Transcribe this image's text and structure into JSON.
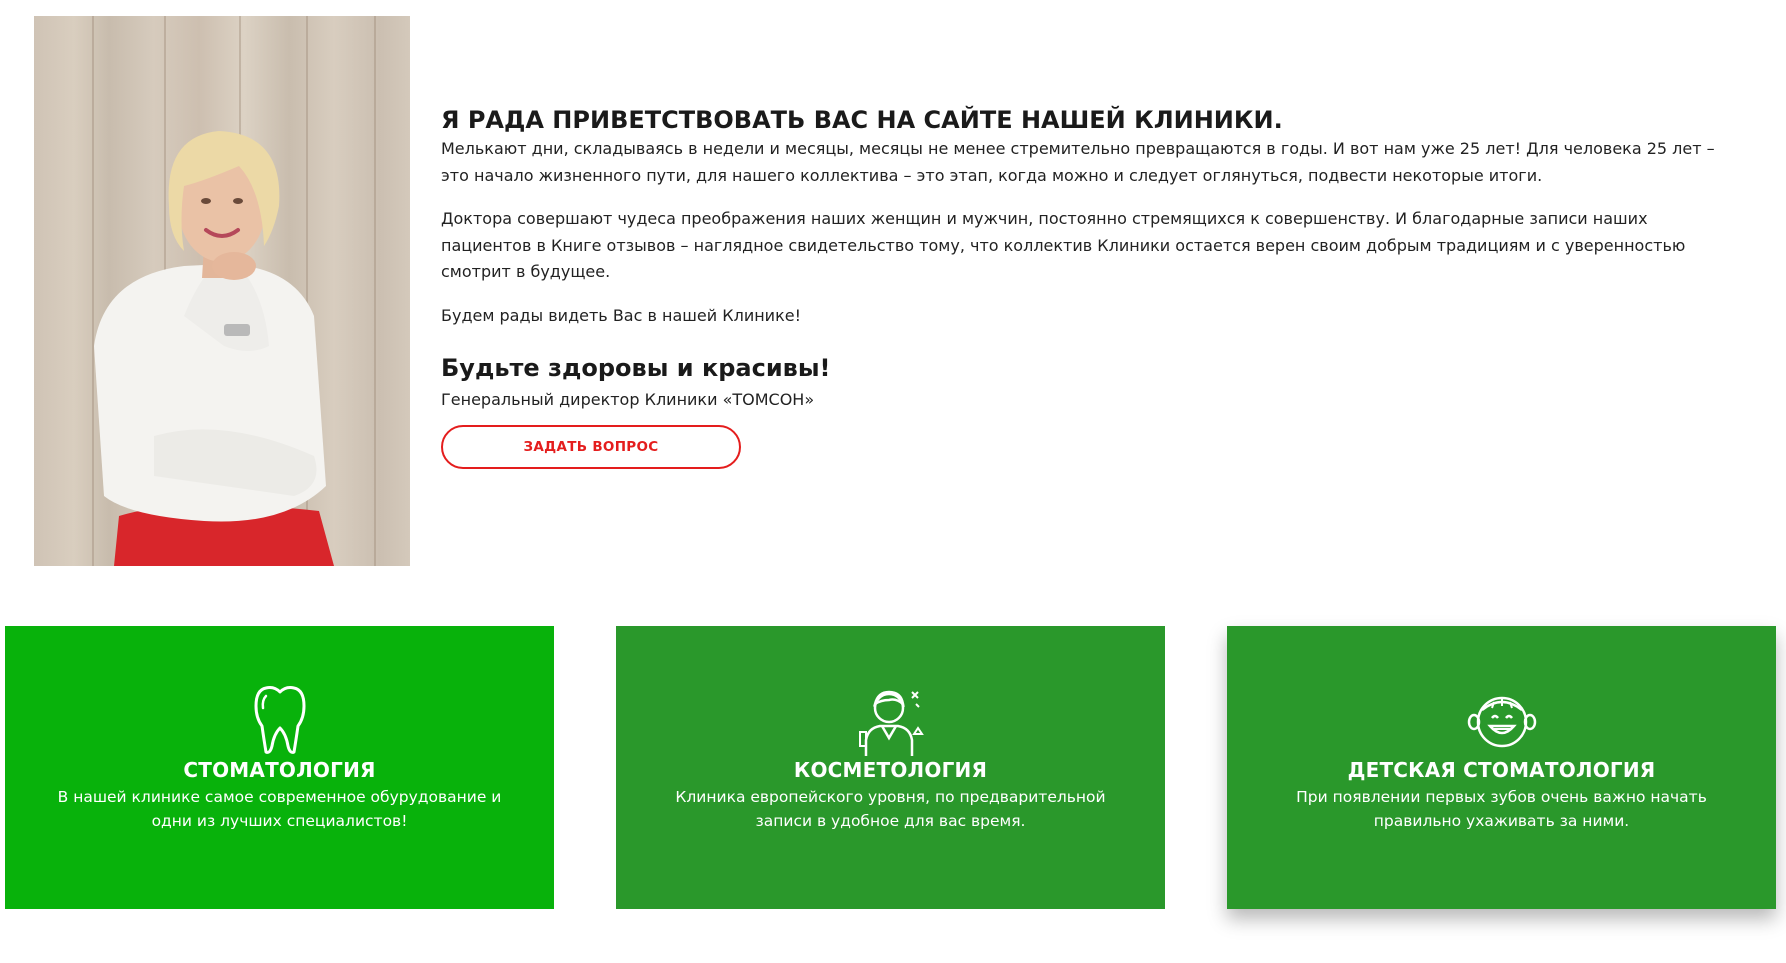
{
  "intro": {
    "title": "Я РАДА ПРИВЕТСТВОВАТЬ ВАС НА САЙТЕ НАШЕЙ КЛИНИКИ.",
    "paragraphs": [
      "Мелькают дни, складываясь в недели и месяцы, месяцы не менее стремительно превращаются в годы. И вот нам уже 25 лет! Для человека 25 лет – это начало жизненного пути, для нашего коллектива – это этап, когда можно и следует оглянуться, подвести некоторые итоги.",
      "Доктора совершают чудеса преображения наших женщин и мужчин, постоянно стремящихся к совершенству. И благодарные записи наших пациентов в Книге отзывов – наглядное свидетельство тому, что коллектив Клиники остается верен своим добрым традициям и с уверенностью смотрит в будущее.",
      "Будем рады видеть Вас в нашей Клинике!"
    ],
    "closing": "Будьте здоровы и красивы!",
    "signature": "Генеральный директор Клиники «ТОМСОН»",
    "button_label": "ЗАДАТЬ ВОПРОС"
  },
  "services": [
    {
      "title": "СТОМАТОЛОГИЯ",
      "text": "В нашей клинике самое современное обурудование и одни из лучших специалистов!",
      "icon": "tooth-icon",
      "color": "#08b20b"
    },
    {
      "title": "КОСМЕТОЛОГИЯ",
      "text": "Клиника европейского уровня, по предварительной записи в удобное для вас время.",
      "icon": "cosmetologist-icon",
      "color": "#2a982b"
    },
    {
      "title": "ДЕТСКАЯ СТОМАТОЛОГИЯ",
      "text": "При появлении первых зубов очень важно начать правильно ухаживать за ними.",
      "icon": "child-smile-icon",
      "color": "#2a982b"
    }
  ],
  "colors": {
    "accent_red": "#e41d1d",
    "card_bright_green": "#08b20b",
    "card_green": "#2a982b"
  }
}
